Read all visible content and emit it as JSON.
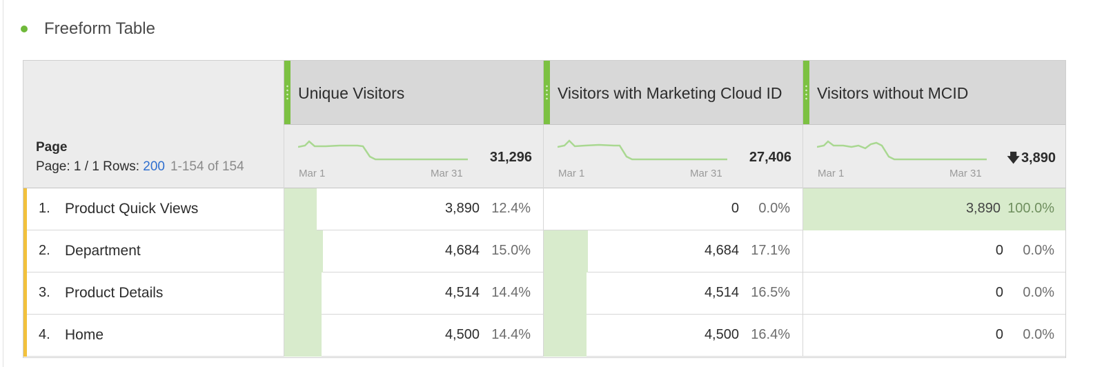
{
  "panel": {
    "title": "Freeform Table",
    "status_color": "#6fb93a"
  },
  "columns": [
    {
      "label": "Unique Visitors"
    },
    {
      "label": "Visitors with Marketing Cloud ID"
    },
    {
      "label": "Visitors without MCID"
    }
  ],
  "dimension": {
    "name": "Page",
    "page_prefix": "Page: 1 / 1  Rows: ",
    "rows_per_page": "200",
    "range_text": "1-154 of 154"
  },
  "summary": [
    {
      "start_label": "Mar 1",
      "end_label": "Mar 31",
      "total": "31,296"
    },
    {
      "start_label": "Mar 1",
      "end_label": "Mar 31",
      "total": "27,406"
    },
    {
      "start_label": "Mar 1",
      "end_label": "Mar 31",
      "total": "3,890",
      "trend_icon": "down-arrow-icon"
    }
  ],
  "rows": [
    {
      "index": "1.",
      "label": "Product Quick Views",
      "cells": [
        {
          "value": "3,890",
          "percent": "12.4%",
          "fraction": 0.124
        },
        {
          "value": "0",
          "percent": "0.0%",
          "fraction": 0.0
        },
        {
          "value": "3,890",
          "percent": "100.0%",
          "fraction": 1.0
        }
      ]
    },
    {
      "index": "2.",
      "label": "Department",
      "cells": [
        {
          "value": "4,684",
          "percent": "15.0%",
          "fraction": 0.15
        },
        {
          "value": "4,684",
          "percent": "17.1%",
          "fraction": 0.171
        },
        {
          "value": "0",
          "percent": "0.0%",
          "fraction": 0.0
        }
      ]
    },
    {
      "index": "3.",
      "label": "Product Details",
      "cells": [
        {
          "value": "4,514",
          "percent": "14.4%",
          "fraction": 0.144
        },
        {
          "value": "4,514",
          "percent": "16.5%",
          "fraction": 0.165
        },
        {
          "value": "0",
          "percent": "0.0%",
          "fraction": 0.0
        }
      ]
    },
    {
      "index": "4.",
      "label": "Home",
      "cells": [
        {
          "value": "4,500",
          "percent": "14.4%",
          "fraction": 0.144
        },
        {
          "value": "4,500",
          "percent": "16.4%",
          "fraction": 0.164
        },
        {
          "value": "0",
          "percent": "0.0%",
          "fraction": 0.0
        }
      ]
    }
  ],
  "colors": {
    "accent_green": "#7cc142",
    "bar_fill": "#d8ebcc",
    "row_marker": "#f2c13c",
    "link_blue": "#2f6fcf"
  }
}
